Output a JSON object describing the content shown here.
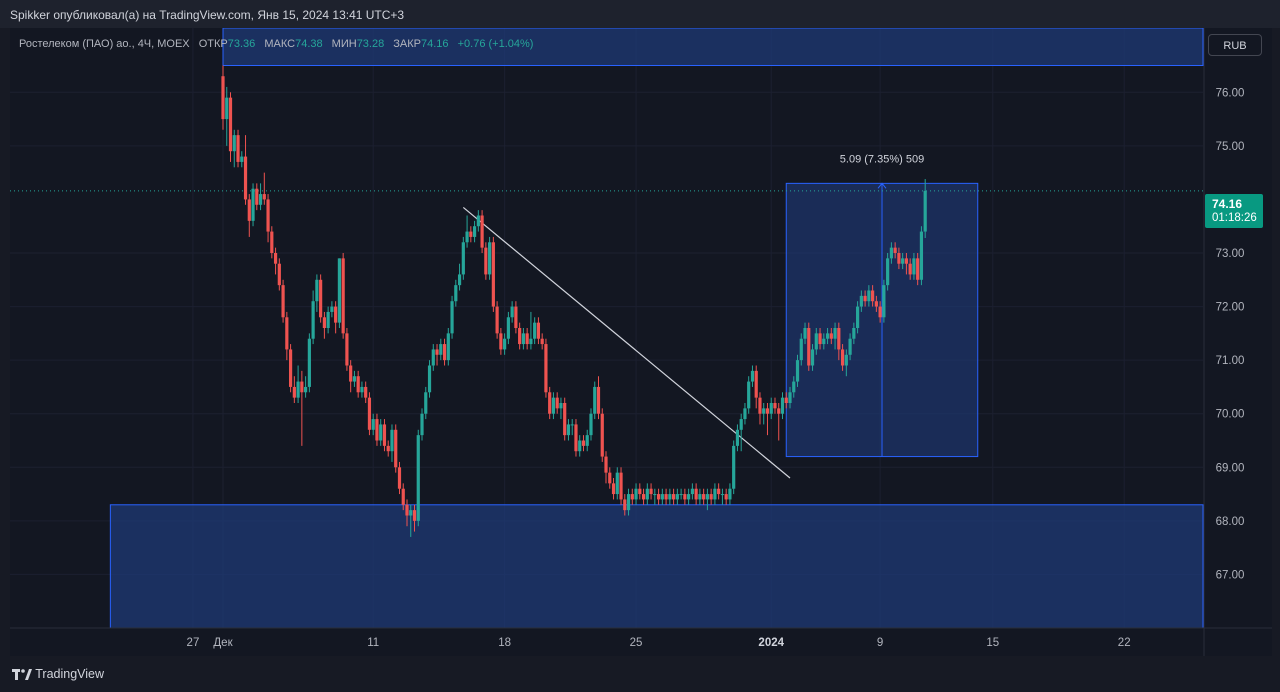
{
  "header": {
    "publisher_line": "Spikker опубликовал(а) на TradingView.com, Янв 15, 2024 13:41 UTC+3"
  },
  "legend": {
    "symbol": "Ростелеком (ПАО) ао., 4Ч, MOEX",
    "open_label": "ОТКР",
    "open_value": "73.36",
    "high_label": "МАКС",
    "high_value": "74.38",
    "low_label": "МИН",
    "low_value": "73.28",
    "close_label": "ЗАКР",
    "close_value": "74.16",
    "change": "+0.76 (+1.04%)"
  },
  "currency": "RUB",
  "price_tag": {
    "price": "74.16",
    "countdown": "01:18:26"
  },
  "brand": {
    "name": "TradingView"
  },
  "colors": {
    "background": "#131722",
    "up": "#26a69a",
    "down": "#ef5350",
    "zone_fill": "#1e3a78",
    "zone_border": "#2962ff",
    "measure": "#2962ff",
    "trendline": "#d1d4dc",
    "price_line": "#26a69a"
  },
  "chart_data": {
    "type": "candlestick",
    "symbol": "Ростелеком (ПАО) ао.",
    "interval": "4Ч",
    "exchange": "MOEX",
    "currency": "RUB",
    "ylim": [
      66.0,
      77.2
    ],
    "y_ticks": [
      "76.00",
      "75.00",
      "73.00",
      "72.00",
      "71.00",
      "70.00",
      "69.00",
      "68.00",
      "67.00"
    ],
    "x_ticks": [
      {
        "label": "27",
        "bar": -8
      },
      {
        "label": "Дек",
        "bar": 0
      },
      {
        "label": "11",
        "bar": 40
      },
      {
        "label": "18",
        "bar": 75
      },
      {
        "label": "25",
        "bar": 110
      },
      {
        "label": "2024",
        "bar": 146,
        "bold": true
      },
      {
        "label": "9",
        "bar": 175
      },
      {
        "label": "15",
        "bar": 205
      },
      {
        "label": "22",
        "bar": 240
      }
    ],
    "last_price": 74.16,
    "candles": [
      [
        76.3,
        75.5,
        76.5,
        75.3
      ],
      [
        75.5,
        75.9,
        76.1,
        75.0
      ],
      [
        75.9,
        74.9,
        76.0,
        74.7
      ],
      [
        74.9,
        75.2,
        75.3,
        74.6
      ],
      [
        75.2,
        74.7,
        75.3,
        74.6
      ],
      [
        74.7,
        74.8,
        74.9,
        74.6
      ],
      [
        74.8,
        74.0,
        75.2,
        73.9
      ],
      [
        74.0,
        73.6,
        74.1,
        73.3
      ],
      [
        73.6,
        74.2,
        74.3,
        73.5
      ],
      [
        74.2,
        73.9,
        74.3,
        73.8
      ],
      [
        73.9,
        74.1,
        74.3,
        73.8
      ],
      [
        74.1,
        74.0,
        74.5,
        73.9
      ],
      [
        74.0,
        73.4,
        74.1,
        73.2
      ],
      [
        73.4,
        73.0,
        73.5,
        72.9
      ],
      [
        73.0,
        72.8,
        73.1,
        72.6
      ],
      [
        72.8,
        72.4,
        72.9,
        72.3
      ],
      [
        72.4,
        71.8,
        72.5,
        71.7
      ],
      [
        71.8,
        71.2,
        71.9,
        71.0
      ],
      [
        71.2,
        70.5,
        71.3,
        70.4
      ],
      [
        70.5,
        70.3,
        70.7,
        70.2
      ],
      [
        70.3,
        70.6,
        70.9,
        70.2
      ],
      [
        70.6,
        70.4,
        70.8,
        69.4
      ],
      [
        70.4,
        70.5,
        70.7,
        70.3
      ],
      [
        70.5,
        71.4,
        71.5,
        70.4
      ],
      [
        71.4,
        72.1,
        72.3,
        71.3
      ],
      [
        72.1,
        72.5,
        72.6,
        71.9
      ],
      [
        72.5,
        71.8,
        72.6,
        71.7
      ],
      [
        71.8,
        71.6,
        71.9,
        71.4
      ],
      [
        71.6,
        71.9,
        72.0,
        71.5
      ],
      [
        71.9,
        72.0,
        72.1,
        71.8
      ],
      [
        72.0,
        71.7,
        72.1,
        71.5
      ],
      [
        71.7,
        72.9,
        72.9,
        71.6
      ],
      [
        72.9,
        71.5,
        73.0,
        71.4
      ],
      [
        71.5,
        70.9,
        71.6,
        70.8
      ],
      [
        70.9,
        70.6,
        71.0,
        70.4
      ],
      [
        70.6,
        70.7,
        70.8,
        70.5
      ],
      [
        70.7,
        70.4,
        70.8,
        70.3
      ],
      [
        70.4,
        70.5,
        70.6,
        70.3
      ],
      [
        70.5,
        70.3,
        70.6,
        70.2
      ],
      [
        70.3,
        69.7,
        70.4,
        69.6
      ],
      [
        69.7,
        69.9,
        70.0,
        69.6
      ],
      [
        69.9,
        69.5,
        70.0,
        69.4
      ],
      [
        69.5,
        69.8,
        69.9,
        69.4
      ],
      [
        69.8,
        69.4,
        69.9,
        69.3
      ],
      [
        69.4,
        69.3,
        69.5,
        69.2
      ],
      [
        69.3,
        69.7,
        69.8,
        69.1
      ],
      [
        69.7,
        69.0,
        69.8,
        68.9
      ],
      [
        69.0,
        68.6,
        69.1,
        68.5
      ],
      [
        68.6,
        68.3,
        68.7,
        68.2
      ],
      [
        68.3,
        68.1,
        68.4,
        67.9
      ],
      [
        68.1,
        68.2,
        68.3,
        67.7
      ],
      [
        68.2,
        68.0,
        68.3,
        67.8
      ],
      [
        68.0,
        69.6,
        69.7,
        67.9
      ],
      [
        69.6,
        70.0,
        70.1,
        69.5
      ],
      [
        70.0,
        70.4,
        70.5,
        69.9
      ],
      [
        70.4,
        70.9,
        71.0,
        70.3
      ],
      [
        70.9,
        71.2,
        71.3,
        70.8
      ],
      [
        71.2,
        71.1,
        71.3,
        70.9
      ],
      [
        71.1,
        71.3,
        71.4,
        71.0
      ],
      [
        71.3,
        71.0,
        71.4,
        70.9
      ],
      [
        71.0,
        71.5,
        71.6,
        70.9
      ],
      [
        71.5,
        72.1,
        72.2,
        71.4
      ],
      [
        72.1,
        72.4,
        72.5,
        72.0
      ],
      [
        72.4,
        72.6,
        72.8,
        72.3
      ],
      [
        72.6,
        73.2,
        73.3,
        72.5
      ],
      [
        73.2,
        73.4,
        73.7,
        73.1
      ],
      [
        73.4,
        73.3,
        73.5,
        73.2
      ],
      [
        73.3,
        73.5,
        73.6,
        73.2
      ],
      [
        73.5,
        73.7,
        73.8,
        73.4
      ],
      [
        73.7,
        73.1,
        73.8,
        73.0
      ],
      [
        73.1,
        72.6,
        73.2,
        72.5
      ],
      [
        72.6,
        73.2,
        73.3,
        72.5
      ],
      [
        73.2,
        72.0,
        73.3,
        71.9
      ],
      [
        72.0,
        71.5,
        72.1,
        71.4
      ],
      [
        71.5,
        71.2,
        71.6,
        71.1
      ],
      [
        71.2,
        71.4,
        71.5,
        71.1
      ],
      [
        71.4,
        71.8,
        71.9,
        71.3
      ],
      [
        71.8,
        72.0,
        72.1,
        71.7
      ],
      [
        72.0,
        71.6,
        72.1,
        71.5
      ],
      [
        71.6,
        71.3,
        71.7,
        71.2
      ],
      [
        71.3,
        71.5,
        71.6,
        71.2
      ],
      [
        71.5,
        71.3,
        71.6,
        71.2
      ],
      [
        71.3,
        71.4,
        71.9,
        71.2
      ],
      [
        71.4,
        71.7,
        71.8,
        71.3
      ],
      [
        71.7,
        71.4,
        71.8,
        71.3
      ],
      [
        71.4,
        71.3,
        71.5,
        71.2
      ],
      [
        71.3,
        70.4,
        71.4,
        70.3
      ],
      [
        70.4,
        70.0,
        70.5,
        69.9
      ],
      [
        70.0,
        70.3,
        70.4,
        69.9
      ],
      [
        70.3,
        70.1,
        70.4,
        70.0
      ],
      [
        70.1,
        70.2,
        70.3,
        69.9
      ],
      [
        70.2,
        69.6,
        70.3,
        69.5
      ],
      [
        69.6,
        69.8,
        69.9,
        69.5
      ],
      [
        69.8,
        69.8,
        69.9,
        69.6
      ],
      [
        69.8,
        69.3,
        69.9,
        69.2
      ],
      [
        69.3,
        69.5,
        69.6,
        69.2
      ],
      [
        69.5,
        69.4,
        69.6,
        69.3
      ],
      [
        69.4,
        69.6,
        69.7,
        69.3
      ],
      [
        69.6,
        70.0,
        70.1,
        69.5
      ],
      [
        70.0,
        70.5,
        70.6,
        69.9
      ],
      [
        70.5,
        70.0,
        70.7,
        69.9
      ],
      [
        70.0,
        69.2,
        70.1,
        69.1
      ],
      [
        69.2,
        68.9,
        69.3,
        68.7
      ],
      [
        68.9,
        68.7,
        69.0,
        68.6
      ],
      [
        68.7,
        68.5,
        68.8,
        68.4
      ],
      [
        68.5,
        68.9,
        69.0,
        68.4
      ],
      [
        68.9,
        68.4,
        69.0,
        68.3
      ],
      [
        68.4,
        68.2,
        68.5,
        68.1
      ],
      [
        68.2,
        68.5,
        68.6,
        68.1
      ],
      [
        68.5,
        68.4,
        68.6,
        68.3
      ],
      [
        68.4,
        68.6,
        68.7,
        68.3
      ],
      [
        68.6,
        68.5,
        68.7,
        68.4
      ],
      [
        68.5,
        68.4,
        68.6,
        68.3
      ],
      [
        68.4,
        68.6,
        68.7,
        68.3
      ],
      [
        68.6,
        68.5,
        68.7,
        68.4
      ],
      [
        68.5,
        68.5,
        68.6,
        68.3
      ],
      [
        68.5,
        68.4,
        68.6,
        68.3
      ],
      [
        68.4,
        68.5,
        68.6,
        68.3
      ],
      [
        68.5,
        68.4,
        68.6,
        68.3
      ],
      [
        68.4,
        68.5,
        68.6,
        68.3
      ],
      [
        68.5,
        68.4,
        68.6,
        68.3
      ],
      [
        68.4,
        68.5,
        68.6,
        68.3
      ],
      [
        68.5,
        68.5,
        68.6,
        68.4
      ],
      [
        68.5,
        68.4,
        68.6,
        68.3
      ],
      [
        68.4,
        68.5,
        68.6,
        68.3
      ],
      [
        68.5,
        68.6,
        68.7,
        68.4
      ],
      [
        68.6,
        68.4,
        68.7,
        68.3
      ],
      [
        68.4,
        68.5,
        68.6,
        68.3
      ],
      [
        68.5,
        68.4,
        68.6,
        68.3
      ],
      [
        68.4,
        68.5,
        68.6,
        68.2
      ],
      [
        68.5,
        68.4,
        68.6,
        68.3
      ],
      [
        68.4,
        68.6,
        68.7,
        68.3
      ],
      [
        68.6,
        68.5,
        68.7,
        68.4
      ],
      [
        68.5,
        68.5,
        68.6,
        68.3
      ],
      [
        68.5,
        68.4,
        68.6,
        68.3
      ],
      [
        68.4,
        68.6,
        68.7,
        68.3
      ],
      [
        68.6,
        69.4,
        69.5,
        68.5
      ],
      [
        69.4,
        69.7,
        69.8,
        69.3
      ],
      [
        69.7,
        69.9,
        70.0,
        69.3
      ],
      [
        69.9,
        70.1,
        70.2,
        69.8
      ],
      [
        70.1,
        70.6,
        70.7,
        70.0
      ],
      [
        70.6,
        70.8,
        70.9,
        70.5
      ],
      [
        70.8,
        70.3,
        70.9,
        70.1
      ],
      [
        70.3,
        70.0,
        70.4,
        69.8
      ],
      [
        70.0,
        70.1,
        70.2,
        69.8
      ],
      [
        70.1,
        70.0,
        70.2,
        69.6
      ],
      [
        70.0,
        70.2,
        70.3,
        69.9
      ],
      [
        70.2,
        70.1,
        70.3,
        70.0
      ],
      [
        70.1,
        70.0,
        70.2,
        69.5
      ],
      [
        70.0,
        70.3,
        70.4,
        69.9
      ],
      [
        70.3,
        70.2,
        70.4,
        70.1
      ],
      [
        70.2,
        70.4,
        70.5,
        70.1
      ],
      [
        70.4,
        70.6,
        70.7,
        70.3
      ],
      [
        70.6,
        71.0,
        71.1,
        70.5
      ],
      [
        71.0,
        71.4,
        71.5,
        70.9
      ],
      [
        71.4,
        71.6,
        71.7,
        71.3
      ],
      [
        71.6,
        70.9,
        71.7,
        70.8
      ],
      [
        70.9,
        71.2,
        71.3,
        70.8
      ],
      [
        71.2,
        71.5,
        71.6,
        71.1
      ],
      [
        71.5,
        71.3,
        71.6,
        71.2
      ],
      [
        71.3,
        71.4,
        71.5,
        71.2
      ],
      [
        71.4,
        71.5,
        71.6,
        71.3
      ],
      [
        71.5,
        71.4,
        71.6,
        71.3
      ],
      [
        71.4,
        71.6,
        71.7,
        71.2
      ],
      [
        71.6,
        71.2,
        71.7,
        71.0
      ],
      [
        71.2,
        70.9,
        71.3,
        70.8
      ],
      [
        70.9,
        71.1,
        71.2,
        70.7
      ],
      [
        71.1,
        71.4,
        71.5,
        71.0
      ],
      [
        71.4,
        71.6,
        71.7,
        71.3
      ],
      [
        71.6,
        72.0,
        72.1,
        71.5
      ],
      [
        72.0,
        72.2,
        72.3,
        71.9
      ],
      [
        72.2,
        72.1,
        72.3,
        72.0
      ],
      [
        72.1,
        72.3,
        72.4,
        72.0
      ],
      [
        72.3,
        72.1,
        72.4,
        72.0
      ],
      [
        72.1,
        72.0,
        72.2,
        71.9
      ],
      [
        72.0,
        71.8,
        72.1,
        71.7
      ],
      [
        71.8,
        72.4,
        72.5,
        71.7
      ],
      [
        72.4,
        72.9,
        73.0,
        72.3
      ],
      [
        72.9,
        73.1,
        73.2,
        72.8
      ],
      [
        73.1,
        73.0,
        73.2,
        72.9
      ],
      [
        73.0,
        72.8,
        73.1,
        72.7
      ],
      [
        72.8,
        72.9,
        73.0,
        72.7
      ],
      [
        72.9,
        72.8,
        73.0,
        72.6
      ],
      [
        72.8,
        72.6,
        72.9,
        72.5
      ],
      [
        72.6,
        72.9,
        73.0,
        72.5
      ],
      [
        72.9,
        72.5,
        73.0,
        72.4
      ],
      [
        72.5,
        73.4,
        73.5,
        72.4
      ],
      [
        73.4,
        74.16,
        74.38,
        73.28
      ]
    ],
    "zones": [
      {
        "name": "resistance-zone",
        "y_top": 77.2,
        "y_bottom": 76.5,
        "start_bar": 0
      },
      {
        "name": "support-zone",
        "y_top": 68.3,
        "y_bottom": 66.0,
        "start_bar": -30
      }
    ],
    "trendline": {
      "from": {
        "bar": 64,
        "price": 73.85
      },
      "to": {
        "bar": 151,
        "price": 68.8
      }
    },
    "measure": {
      "label": "5.09 (7.35%) 509",
      "start_bar": 150,
      "end_bar": 201,
      "y_top": 74.3,
      "y_bottom": 69.2
    }
  }
}
